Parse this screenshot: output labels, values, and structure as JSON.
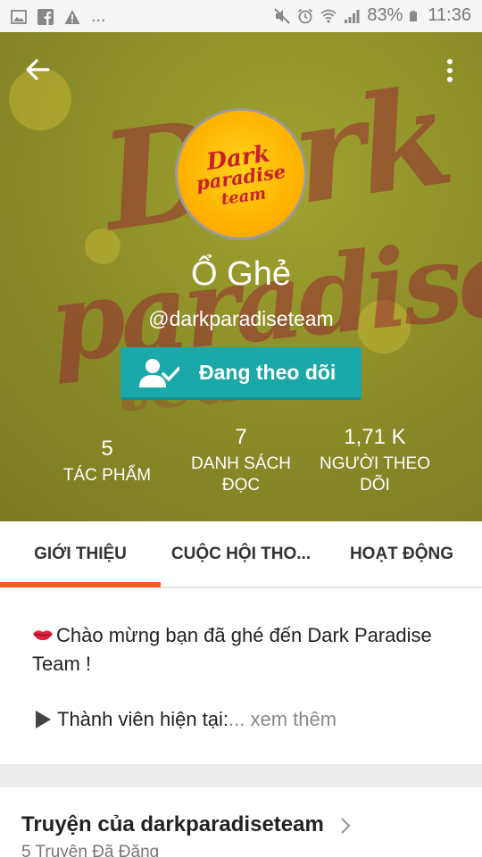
{
  "status_bar": {
    "dots": "...",
    "battery_percent": "83%",
    "time": "11:36"
  },
  "header": {
    "background_text": [
      "Dark",
      "paradise",
      "team"
    ],
    "avatar_logo": [
      "Dark",
      "paradise",
      "team"
    ],
    "name": "Ổ Ghẻ",
    "handle": "@darkparadiseteam",
    "follow_label": "Đang theo dõi",
    "accent_color": "#1aa8a8"
  },
  "stats": [
    {
      "value": "5",
      "label": "TÁC PHẨM"
    },
    {
      "value": "7",
      "label_line1": "DANH SÁCH",
      "label_line2": "ĐỌC"
    },
    {
      "value": "1,71 K",
      "label_line1": "NGƯỜI THEO",
      "label_line2": "DÕI"
    }
  ],
  "tabs": [
    {
      "label": "GIỚI THIỆU",
      "active": true
    },
    {
      "label": "CUỘC HỘI THO..."
    },
    {
      "label": "HOẠT ĐỘNG"
    }
  ],
  "tab_indicator_color": "#ff5a1f",
  "about": {
    "line1": "Chào mừng bạn đã ghé đến Dark Paradise Team !",
    "line2": "Thành viên hiện tại:",
    "see_more": "... xem thêm"
  },
  "stories": {
    "title": "Truyện của darkparadiseteam",
    "subtitle": "5 Truyện Đã Đăng"
  }
}
